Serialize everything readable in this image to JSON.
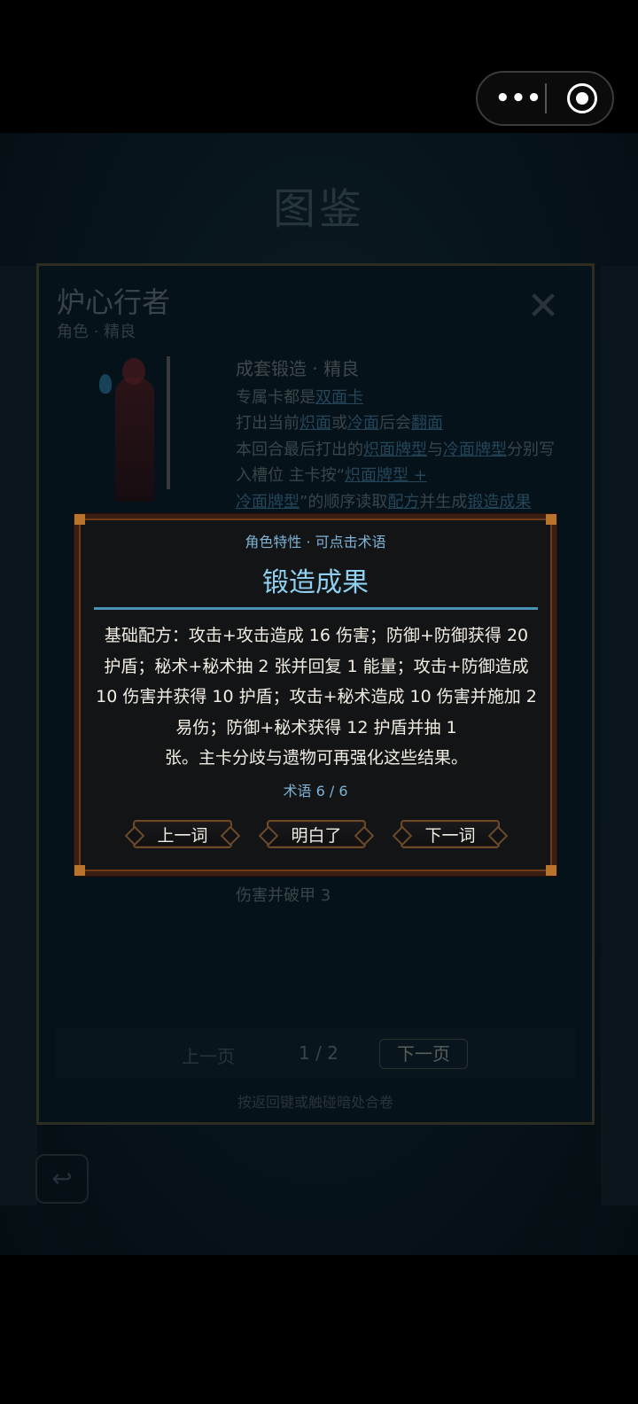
{
  "top_bar": {
    "menu_icon": "more-dots-icon",
    "close_icon": "target-circle-icon"
  },
  "codex": {
    "title": "图鉴",
    "character": {
      "name": "炉心行者",
      "subtitle": "角色 · 精良",
      "set_heading": "成套锻造 · 精良",
      "line1_prefix": "专属卡都是",
      "line1_kw": "双面卡",
      "line2_prefix": "打出当前",
      "line2_kw1": "炽面",
      "line2_mid": "或",
      "line2_kw2": "冷面",
      "line2_mid2": "后会",
      "line2_kw3": "翻面",
      "line3_prefix": "本回合最后打出的",
      "line3_kw1": "炽面牌型",
      "line3_mid": "与",
      "line3_kw2": "冷面牌型",
      "line3_suffix": "分别写",
      "line4_prefix": "入槽位  主卡按“",
      "line4_kw": "炽面牌型 +",
      "line5_kw": "冷面牌型",
      "line5_mid": "”的顺序读取",
      "line5_kw2": "配方",
      "line5_mid2": "并生成",
      "line5_kw3": "锻造成果",
      "tail": "伤害并破甲 3"
    },
    "pager": {
      "prev": "上一页",
      "page": "1 / 2",
      "next": "下一页"
    },
    "hint": "按返回键或触碰暗处合卷",
    "back_icon": "return-arrow-icon"
  },
  "modal": {
    "tag": "角色特性 · 可点击术语",
    "title": "锻造成果",
    "body_lines": [
      "基础配方：攻击+攻击造成 16 伤害；防御+防御获得 20",
      "护盾；秘术+秘术抽 2 张并回复 1 能量；攻击+防御造成",
      "10 伤害并获得 10 护盾；攻击+秘术造成 10 伤害并施加 2",
      "易伤；防御+秘术获得 12 护盾并抽 1",
      "张。主卡分歧与遗物可再强化这些结果。"
    ],
    "counter": "术语 6 / 6",
    "buttons": {
      "prev": "上一词",
      "ok": "明白了",
      "next": "下一词"
    }
  },
  "colors": {
    "accent": "#8fd0f0",
    "frame": "#6d3a1a",
    "keyword": "#24465a"
  }
}
